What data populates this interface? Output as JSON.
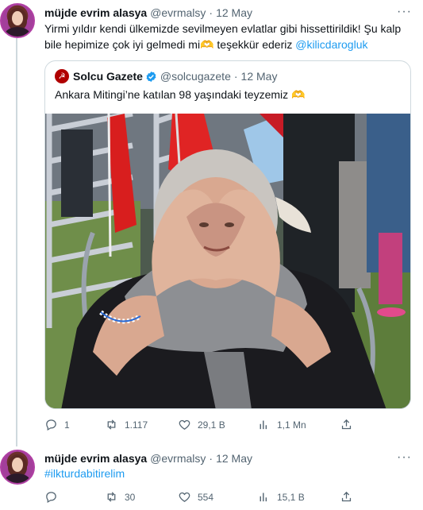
{
  "tweet1": {
    "author_name": "müjde evrim alasya",
    "handle": "@evrmalsy",
    "separator": "·",
    "date": "12 May",
    "more": "···",
    "text_part1": "Yirmi yıldır kendi ülkemizde sevilmeyen evlatlar gibi hissettirildik! Şu kalp bile hepimize çok iyi gelmedi mi",
    "heart_emoji": "🫶",
    "text_part2": " teşekkür ederiz ",
    "mention": "@kilicdarogluk",
    "quote": {
      "author_name": "Solcu Gazete",
      "avatar_glyph": "☭",
      "handle": "@solcugazete",
      "separator": "·",
      "date": "12 May",
      "text": "Ankara Mitingi’ne katılan 98 yaşındaki teyzemiz",
      "emoji": "🫶"
    },
    "actions": {
      "reply_count": "1",
      "retweet_count": "1.117",
      "like_count": "29,1 B",
      "views_count": "1,1 Mn"
    }
  },
  "tweet2": {
    "author_name": "müjde evrim alasya",
    "handle": "@evrmalsy",
    "separator": "·",
    "date": "12 May",
    "more": "···",
    "hashtag": "#ilkturdabitirelim",
    "actions": {
      "reply_count": "",
      "retweet_count": "30",
      "like_count": "554",
      "views_count": "15,1 B"
    }
  },
  "colors": {
    "link": "#1d9bf0",
    "secondary_text": "#536471",
    "border": "#cfd9de",
    "verified": "#1d9bf0"
  }
}
